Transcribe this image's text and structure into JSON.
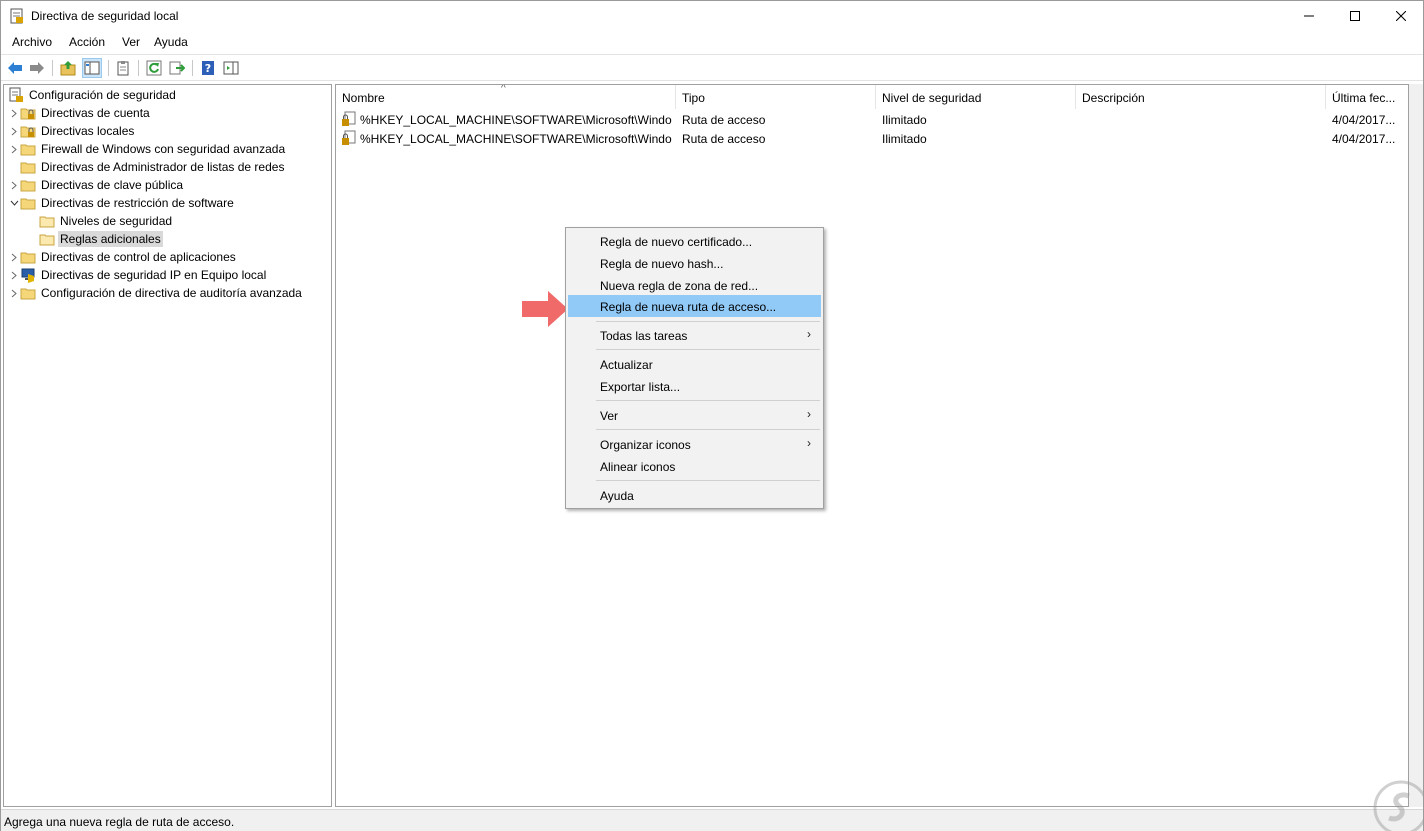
{
  "window": {
    "title": "Directiva de seguridad local"
  },
  "menubar": [
    "Archivo",
    "Acción",
    "Ver",
    "Ayuda"
  ],
  "toolbar": {
    "buttons": [
      "back-icon",
      "forward-icon",
      "up-folder-icon",
      "show-hide-tree-icon",
      "clipboard-icon",
      "refresh-icon",
      "export-list-icon",
      "help-icon",
      "show-action-pane-icon"
    ]
  },
  "tree": {
    "root": "Configuración de seguridad",
    "items": [
      {
        "label": "Directivas de cuenta"
      },
      {
        "label": "Directivas locales"
      },
      {
        "label": "Firewall de Windows con seguridad avanzada"
      },
      {
        "label": "Directivas de Administrador de listas de redes"
      },
      {
        "label": "Directivas de clave pública"
      },
      {
        "label": "Directivas de restricción de software"
      },
      {
        "label": "Niveles de seguridad"
      },
      {
        "label": "Reglas adicionales"
      },
      {
        "label": "Directivas de control de aplicaciones"
      },
      {
        "label": "Directivas de seguridad IP en Equipo local"
      },
      {
        "label": "Configuración de directiva de auditoría avanzada"
      }
    ]
  },
  "list": {
    "columns": [
      "Nombre",
      "Tipo",
      "Nivel de seguridad",
      "Descripción",
      "Última fec..."
    ],
    "sort_indicator": "^",
    "rows": [
      {
        "nombre": "%HKEY_LOCAL_MACHINE\\SOFTWARE\\Microsoft\\Windo...",
        "tipo": "Ruta de acceso",
        "nivel": "Ilimitado",
        "descripcion": "",
        "fecha": "4/04/2017..."
      },
      {
        "nombre": "%HKEY_LOCAL_MACHINE\\SOFTWARE\\Microsoft\\Windo...",
        "tipo": "Ruta de acceso",
        "nivel": "Ilimitado",
        "descripcion": "",
        "fecha": "4/04/2017..."
      }
    ]
  },
  "context_menu": {
    "items": [
      {
        "label": "Regla de nuevo certificado..."
      },
      {
        "label": "Regla de nuevo hash..."
      },
      {
        "label": "Nueva regla de zona de red..."
      },
      {
        "label": "Regla de nueva ruta de acceso...",
        "highlighted": true
      },
      {
        "label": "Todas las tareas",
        "submenu": true
      },
      {
        "label": "Actualizar"
      },
      {
        "label": "Exportar lista..."
      },
      {
        "label": "Ver",
        "submenu": true
      },
      {
        "label": "Organizar iconos",
        "submenu": true
      },
      {
        "label": "Alinear iconos"
      },
      {
        "label": "Ayuda"
      }
    ],
    "submenu_glyph": "›"
  },
  "status": {
    "text": "Agrega una nueva regla de ruta de acceso."
  },
  "colors": {
    "highlight": "#91c9f7",
    "arrow": "#f06a6a",
    "folder": "#f5d77a"
  }
}
